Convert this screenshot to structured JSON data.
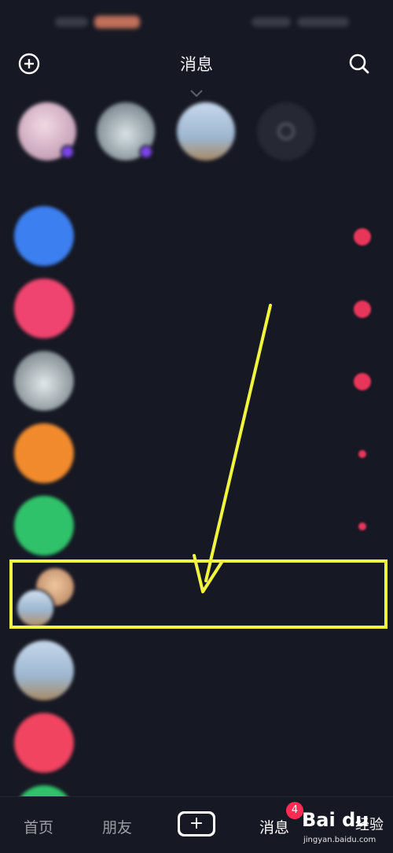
{
  "header": {
    "title": "消息",
    "add_icon": "plus-circle-icon",
    "search_icon": "search-icon"
  },
  "friends": [
    {
      "name": "",
      "color": "#d8bccc",
      "badge": true
    },
    {
      "name": "",
      "color": "#8c9aa2",
      "badge": true
    },
    {
      "name": "",
      "color": "#a9c2d8",
      "badge": false
    },
    {
      "name": "",
      "color": "#2a2c36",
      "badge": false
    }
  ],
  "messages": [
    {
      "title": "",
      "subtitle": "",
      "time": "",
      "avatar_color": "#3c7ff0",
      "unread": "dot"
    },
    {
      "title": "",
      "subtitle": "",
      "time": "",
      "avatar_color": "#f04470",
      "unread": "dot"
    },
    {
      "title": "",
      "subtitle": "",
      "time": "",
      "avatar_color": "#a7b1b6",
      "unread": "dot"
    },
    {
      "title": "",
      "subtitle": "",
      "time": "",
      "avatar_color": "#f08a2c",
      "unread": "small"
    },
    {
      "title": "",
      "subtitle": "",
      "time": "",
      "avatar_color": "#2fc26a",
      "unread": "small"
    },
    {
      "title": "",
      "subtitle": "",
      "time": "",
      "avatar_color": "#e7b590",
      "unread": "none",
      "group": true
    },
    {
      "title": "",
      "subtitle": "",
      "time": "",
      "avatar_color": "#9fb8d4",
      "unread": "none"
    },
    {
      "title": "",
      "subtitle": "",
      "time": "",
      "avatar_color": "#f04460",
      "unread": "none"
    }
  ],
  "tabbar": {
    "home": "首页",
    "friends": "朋友",
    "create": "+",
    "messages": "消息",
    "messages_badge": "4"
  },
  "watermark": {
    "logo": "Bai du",
    "cn": "经验",
    "url": "jingyan.baidu.com"
  },
  "colors": {
    "background": "#161823",
    "annotation": "#f2f53e",
    "badge": "#fe2c55"
  }
}
